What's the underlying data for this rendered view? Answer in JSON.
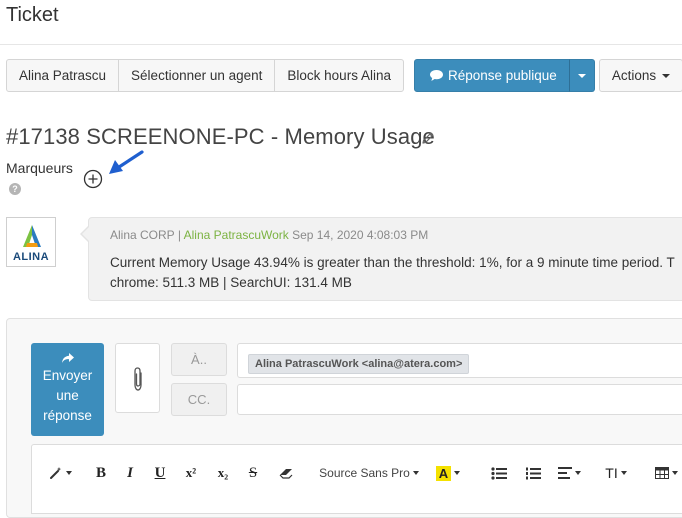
{
  "page": {
    "title": "Ticket"
  },
  "toolbar": {
    "assignee_label": "Alina Patrascu",
    "select_agent_label": "Sélectionner un agent",
    "block_hours_label": "Block hours Alina",
    "public_reply_label": "Réponse publique",
    "actions_label": "Actions"
  },
  "ticket": {
    "title": "#17138 SCREENONE-PC - Memory Usage",
    "markers_label": "Marqueurs",
    "help_glyph": "?"
  },
  "message": {
    "org": "Alina CORP",
    "separator": "|",
    "author": "Alina PatrascuWork",
    "timestamp": "Sep 14, 2020 4:08:03 PM",
    "body_line1": "Current Memory Usage 43.94% is greater than the threshold: 1%, for a 9 minute time period. T",
    "body_line2": "chrome: 511.3 MB | SearchUI: 131.4 MB",
    "logo_text": "ALINA"
  },
  "reply": {
    "send_line1": "Envoyer",
    "send_line2": "une",
    "send_line3": "réponse",
    "to_label": "À..",
    "cc_label": "CC.",
    "to_recipient": "Alina PatrascuWork <alina@atera.com>"
  },
  "editor": {
    "bold": "B",
    "italic": "I",
    "underline": "U",
    "superscript": "x²",
    "subscript": "x₂",
    "strike": "S",
    "font_family": "Source Sans Pro",
    "highlight": "A",
    "text_size": "TI"
  },
  "colors": {
    "primary": "#3c8dbc",
    "agent_link": "#7cb342",
    "annotation_arrow": "#1f5fcf"
  }
}
